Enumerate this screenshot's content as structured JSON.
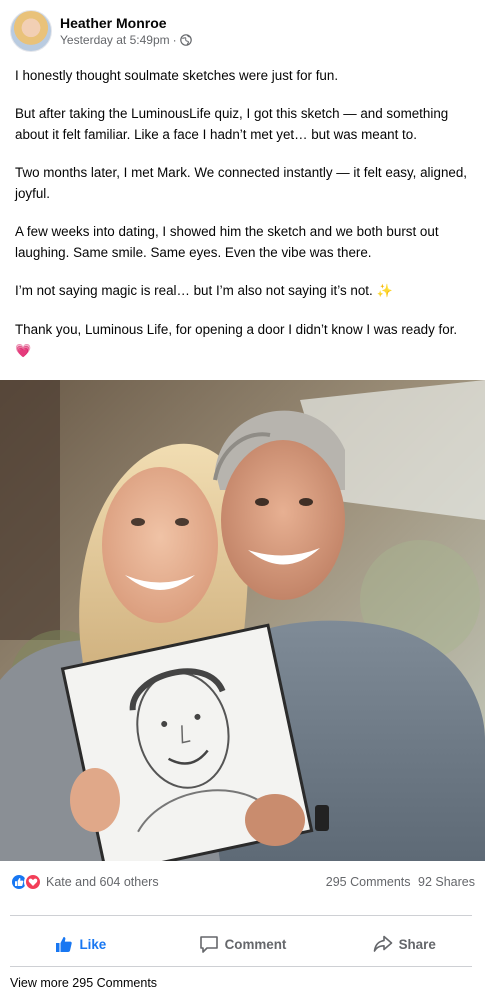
{
  "post": {
    "author": "Heather Monroe",
    "timestamp": "Yesterday at 5:49pm",
    "separator": "·",
    "privacy_icon": "globe-icon",
    "paragraphs": [
      "I honestly thought soulmate sketches were just for fun.",
      "But after taking the LuminousLife quiz, I got this sketch — and something about it felt familiar. Like a face I hadn’t met yet… but was meant to.",
      "Two months later, I met Mark. We connected instantly — it felt easy, aligned, joyful.",
      "A few weeks into dating, I showed him the sketch and we both burst out laughing. Same smile. Same eyes. Even the vibe was there."
    ],
    "paragraph_sparkle": "I’m not saying magic is real… but I’m also not saying it’s not.",
    "sparkle_emoji": "✨",
    "paragraph_heart": "Thank you, Luminous Life, for opening a door I didn’t know I was ready for.",
    "heart_emoji": "💗"
  },
  "engagement": {
    "reaction_icons": [
      "like-icon",
      "love-icon"
    ],
    "reactions_text": "Kate and 604 others",
    "comments": "295 Comments",
    "shares": "92 Shares"
  },
  "actions": {
    "like": "Like",
    "comment": "Comment",
    "share": "Share"
  },
  "footer": {
    "view_more": "View more 295 Comments"
  },
  "colors": {
    "accent": "#1877f2",
    "love": "#f33e58",
    "muted": "#65676b"
  }
}
